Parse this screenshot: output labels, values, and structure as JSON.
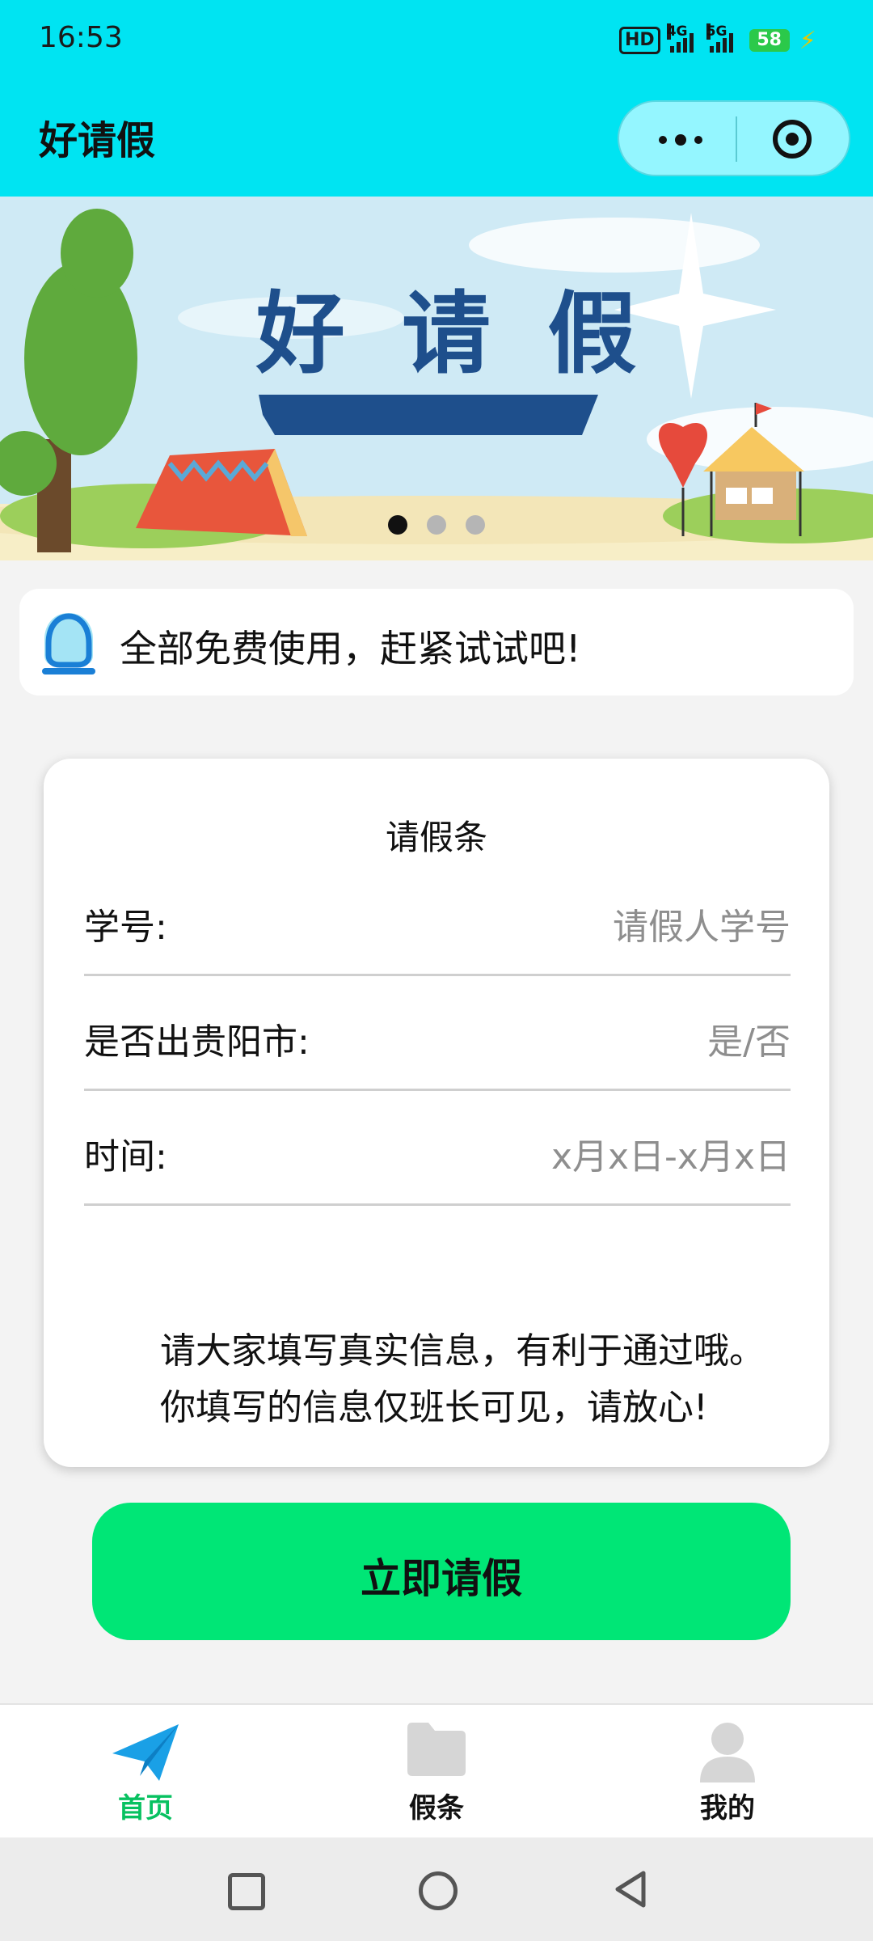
{
  "status_bar": {
    "time": "16:53",
    "hd_label": "HD",
    "network_1": "4G",
    "network_2": "5G",
    "battery": "58"
  },
  "header": {
    "title": "好请假",
    "more_icon": "more-dots-icon",
    "close_icon": "target-close-icon"
  },
  "banner": {
    "headline": "好 请 假",
    "slide_count": 3,
    "active_slide": 1
  },
  "notice": {
    "icon": "customer-service-icon",
    "text": "全部免费使用，赶紧试试吧!"
  },
  "form": {
    "title": "请假条",
    "fields": [
      {
        "label": "学号:",
        "placeholder": "请假人学号"
      },
      {
        "label": "是否出贵阳市:",
        "placeholder": "是/否"
      },
      {
        "label": "时间:",
        "placeholder": "x月x日-x月x日"
      }
    ],
    "note_line1": "请大家填写真实信息，有利于通过哦。",
    "note_line2": "你填写的信息仅班长可见，请放心!"
  },
  "submit": {
    "label": "立即请假",
    "color": "#00e676"
  },
  "tabbar": {
    "items": [
      {
        "label": "首页",
        "icon": "paper-plane-icon",
        "active": true
      },
      {
        "label": "假条",
        "icon": "folder-icon",
        "active": false
      },
      {
        "label": "我的",
        "icon": "user-icon",
        "active": false
      }
    ],
    "active_color": "#07c160"
  },
  "colors": {
    "header_bg": "#00e4f2",
    "accent": "#00e676"
  }
}
